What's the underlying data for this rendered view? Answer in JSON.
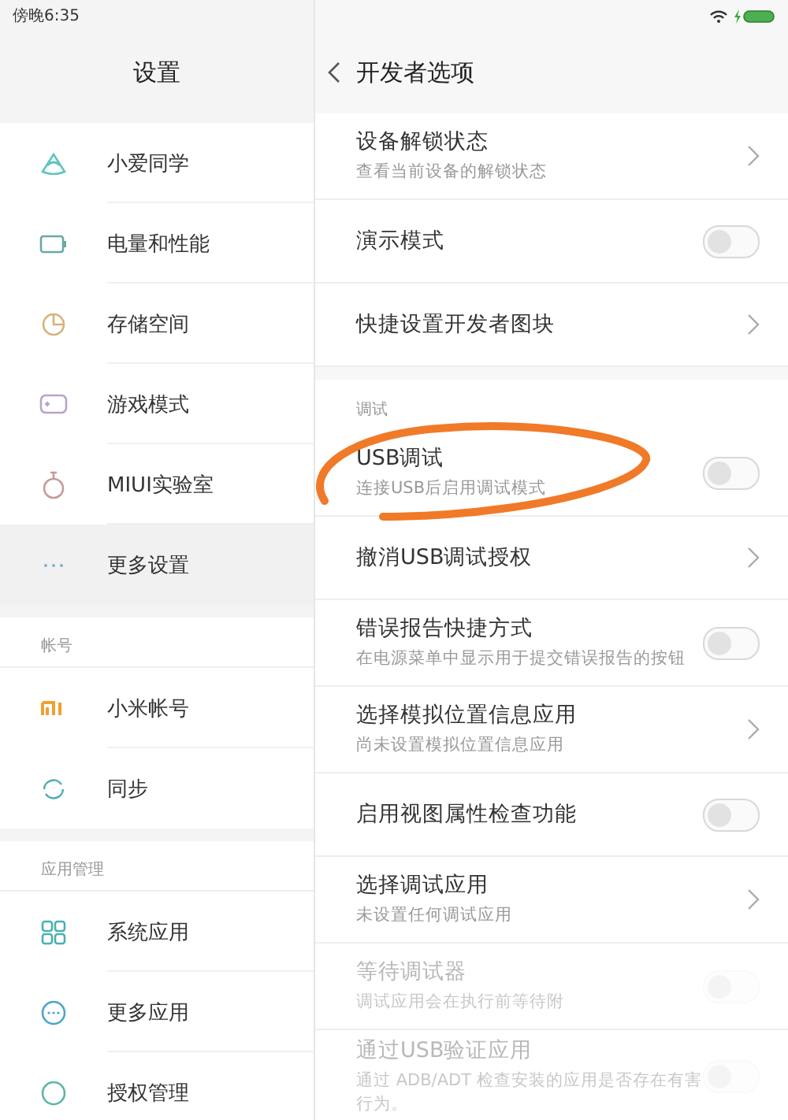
{
  "status_bar": {
    "time": "傍晚6:35"
  },
  "sidebar": {
    "title": "设置",
    "sections": [
      {
        "items": [
          {
            "label": "小爱同学",
            "selected": false
          },
          {
            "label": "电量和性能",
            "selected": false
          },
          {
            "label": "存储空间",
            "selected": false
          },
          {
            "label": "游戏模式",
            "selected": false
          },
          {
            "label": "MIUI实验室",
            "selected": false
          },
          {
            "label": "更多设置",
            "selected": true
          }
        ]
      },
      {
        "header": "帐号",
        "items": [
          {
            "label": "小米帐号",
            "selected": false
          },
          {
            "label": "同步",
            "selected": false
          }
        ]
      },
      {
        "header": "应用管理",
        "items": [
          {
            "label": "系统应用",
            "selected": false
          },
          {
            "label": "更多应用",
            "selected": false
          },
          {
            "label": "授权管理",
            "selected": false
          }
        ]
      }
    ]
  },
  "detail": {
    "title": "开发者选项",
    "sections": [
      {
        "items": [
          {
            "kind": "link",
            "title": "设备解锁状态",
            "subtitle": "查看当前设备的解锁状态",
            "disabled": false
          },
          {
            "kind": "toggle",
            "title": "演示模式",
            "on": false,
            "disabled": false
          },
          {
            "kind": "link",
            "title": "快捷设置开发者图块",
            "disabled": false
          }
        ]
      },
      {
        "header": "调试",
        "items": [
          {
            "kind": "toggle",
            "title": "USB调试",
            "subtitle": "连接USB后启用调试模式",
            "on": false,
            "disabled": false
          },
          {
            "kind": "link",
            "title": "撤消USB调试授权",
            "disabled": false
          },
          {
            "kind": "toggle",
            "title": "错误报告快捷方式",
            "subtitle": "在电源菜单中显示用于提交错误报告的按钮",
            "on": false,
            "disabled": false
          },
          {
            "kind": "link",
            "title": "选择模拟位置信息应用",
            "subtitle": "尚未设置模拟位置信息应用",
            "disabled": false
          },
          {
            "kind": "toggle",
            "title": "启用视图属性检查功能",
            "on": false,
            "disabled": false
          },
          {
            "kind": "link",
            "title": "选择调试应用",
            "subtitle": "未设置任何调试应用",
            "disabled": false
          },
          {
            "kind": "toggle",
            "title": "等待调试器",
            "subtitle": "调试应用会在执行前等待附",
            "on": false,
            "disabled": true
          },
          {
            "kind": "toggle",
            "title": "通过USB验证应用",
            "subtitle": "通过 ADB/ADT 检查安装的应用是否存在有害行为。",
            "on": false,
            "disabled": true
          }
        ]
      }
    ]
  }
}
